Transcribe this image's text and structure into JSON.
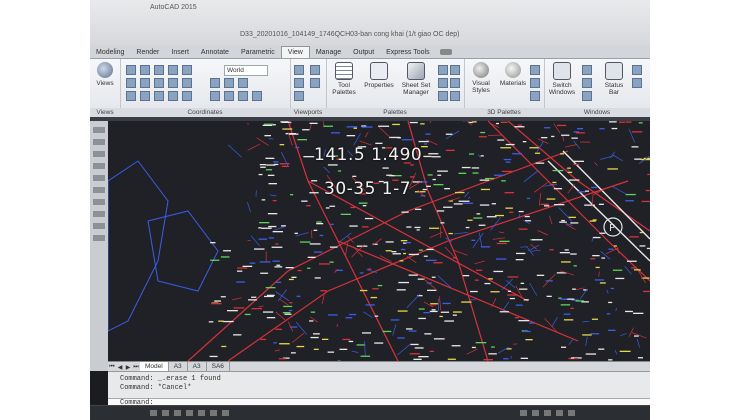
{
  "app": {
    "title": "AutoCAD 2015",
    "document_title": "D33_20201016_104149_1746QCH03-ban cong khai (1/t giao OC dep)"
  },
  "ribbon_tabs": [
    {
      "label": "Modeling",
      "active": false
    },
    {
      "label": "Render",
      "active": false
    },
    {
      "label": "Insert",
      "active": false
    },
    {
      "label": "Annotate",
      "active": false
    },
    {
      "label": "Parametric",
      "active": false
    },
    {
      "label": "View",
      "active": true
    },
    {
      "label": "Manage",
      "active": false
    },
    {
      "label": "Output",
      "active": false
    },
    {
      "label": "Express Tools",
      "active": false
    }
  ],
  "ribbon": {
    "views_button": "Views",
    "ucs_world": "World",
    "panels": {
      "views": "Views",
      "coordinates": "Coordinates",
      "viewports": "Viewports",
      "palettes": "Palettes",
      "palettes_3d": "3D Palettes",
      "windows": "Windows"
    },
    "buttons": {
      "tool_palettes": "Tool Palettes",
      "properties": "Properties",
      "sheet_set_manager": "Sheet Set Manager",
      "visual_styles": "Visual Styles",
      "materials": "Materials",
      "switch_windows": "Switch Windows",
      "status_bar": "Status Bar"
    }
  },
  "drawing": {
    "overlay_line1": "141.5 1.490",
    "overlay_line2": "30-35 1-7"
  },
  "layout_tabs": [
    {
      "label": "Model",
      "active": true
    },
    {
      "label": "A3",
      "active": false
    },
    {
      "label": "A3",
      "active": false
    },
    {
      "label": "SA6",
      "active": false
    }
  ],
  "command": {
    "history": [
      "Command:  _.erase 1 found",
      "Command: *Cancel*"
    ],
    "prompt": "Command:"
  },
  "colors": {
    "canvas": "#1f2126",
    "ribbon": "#e2e5ea",
    "line_red": "#d8323a",
    "line_blue": "#3a5ee8",
    "line_white": "#e8e8e8",
    "line_green": "#5fd35a"
  }
}
